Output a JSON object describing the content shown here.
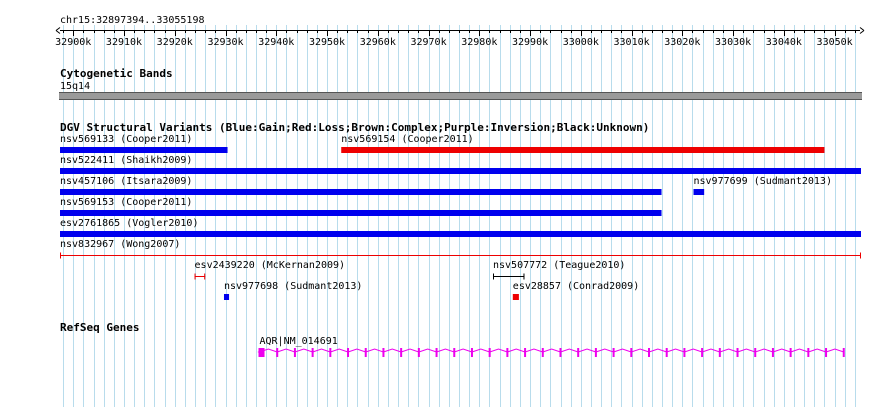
{
  "location": "chr15:32897394..33055198",
  "ruler": {
    "start": 32897394,
    "end": 33055198,
    "ticks": [
      "32900k",
      "32910k",
      "32920k",
      "32930k",
      "32940k",
      "32950k",
      "32960k",
      "32970k",
      "32980k",
      "32990k",
      "33000k",
      "33010k",
      "33020k",
      "33030k",
      "33040k",
      "33050k"
    ]
  },
  "cytoband": {
    "title": "Cytogenetic Bands",
    "band": "15q14"
  },
  "dgv": {
    "title": "DGV Structural Variants (Blue:Gain;Red:Loss;Brown:Complex;Purple:Inversion;Black:Unknown)",
    "features": [
      {
        "label": "nsv569133 (Cooper2011)",
        "start": 32897394,
        "end": 32930400,
        "color": "#0000ee",
        "style": "bar"
      },
      {
        "label": "nsv569154 (Cooper2011)",
        "start": 32952800,
        "end": 33048000,
        "color": "#ee0000",
        "style": "bar"
      },
      {
        "label": "nsv522411 (Shaikh2009)",
        "start": 32897394,
        "end": 33055198,
        "color": "#0000ee",
        "style": "bar"
      },
      {
        "label": "nsv457106 (Itsara2009)",
        "start": 32897394,
        "end": 33015900,
        "color": "#0000ee",
        "style": "bar"
      },
      {
        "label": "nsv977699 (Sudmant2013)",
        "start": 33022200,
        "end": 33024300,
        "color": "#0000ee",
        "style": "bar"
      },
      {
        "label": "nsv569153 (Cooper2011)",
        "start": 32897394,
        "end": 33015900,
        "color": "#0000ee",
        "style": "bar"
      },
      {
        "label": "esv2761865 (Vogler2010)",
        "start": 32897394,
        "end": 33055198,
        "color": "#0000ee",
        "style": "bar"
      },
      {
        "label": "nsv832967 (Wong2007)",
        "start": 32897394,
        "end": 33055198,
        "color": "#ee0000",
        "style": "line"
      },
      {
        "label": "esv2439220 (McKernan2009)",
        "start": 32923900,
        "end": 32926000,
        "color": "#ee0000",
        "style": "line"
      },
      {
        "label": "nsv507772 (Teague2010)",
        "start": 32982700,
        "end": 32988900,
        "color": "#000000",
        "style": "line"
      },
      {
        "label": "nsv977698 (Sudmant2013)",
        "start": 32929700,
        "end": 32930700,
        "color": "#0000ee",
        "style": "bar"
      },
      {
        "label": "esv28857 (Conrad2009)",
        "start": 32986600,
        "end": 32987800,
        "color": "#ee0000",
        "style": "bar"
      }
    ]
  },
  "refseq": {
    "title": "RefSeq Genes",
    "gene_label": "AQR|NM_014691",
    "gene_start": 32936700,
    "gene_end": 33051800,
    "color": "#ee00ee"
  }
}
